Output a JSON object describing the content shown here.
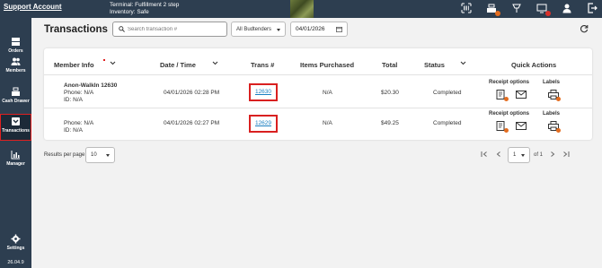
{
  "topbar": {
    "account_label": "Support Account",
    "terminal_line": "Terminal: Fulfillment 2 step",
    "inventory_line": "Inventory: Safe",
    "icons": [
      "barcode-scan-icon",
      "cash-register-icon",
      "pos-terminal-icon",
      "display-icon",
      "user-icon",
      "logout-icon"
    ]
  },
  "sidebar": {
    "items": [
      {
        "label": "Orders",
        "icon": "orders-icon"
      },
      {
        "label": "Members",
        "icon": "members-icon"
      },
      {
        "label": "Cash Drawer",
        "icon": "cash-drawer-icon"
      },
      {
        "label": "Transactions",
        "icon": "transactions-icon",
        "active": true
      },
      {
        "label": "Manager",
        "icon": "manager-icon"
      },
      {
        "label": "Settings",
        "icon": "settings-icon"
      }
    ],
    "version": "26.04.9"
  },
  "page": {
    "title": "Transactions",
    "search_placeholder": "Search transaction #",
    "budtender_filter": "All Budtenders",
    "date_filter": "04/01/2026"
  },
  "table": {
    "headers": {
      "member": "Member Info",
      "datetime": "Date / Time",
      "trans": "Trans #",
      "items": "Items Purchased",
      "total": "Total",
      "status": "Status",
      "actions": "Quick Actions"
    },
    "rows": [
      {
        "member_name": "Anon-WalkIn 12630",
        "phone_label": "Phone:",
        "phone": "N/A",
        "id_label": "ID:",
        "id": "N/A",
        "datetime": "04/01/2026 02:28 PM",
        "trans": "12630",
        "items": "N/A",
        "total": "$20.30",
        "status": "Completed",
        "receipt_label": "Receipt options",
        "labels_label": "Labels"
      },
      {
        "member_name": "",
        "phone_label": "Phone:",
        "phone": "N/A",
        "id_label": "ID:",
        "id": "N/A",
        "datetime": "04/01/2026 02:27 PM",
        "trans": "12629",
        "items": "N/A",
        "total": "$49.25",
        "status": "Completed",
        "receipt_label": "Receipt options",
        "labels_label": "Labels"
      }
    ]
  },
  "footer": {
    "rpp_label": "Results per page",
    "rpp_value": "10",
    "page_value": "1",
    "page_of": "of 1"
  },
  "colors": {
    "sidebar": "#2d3e50",
    "highlight": "#d92020",
    "link": "#1a7fc1",
    "badge": "#e46d1f"
  }
}
